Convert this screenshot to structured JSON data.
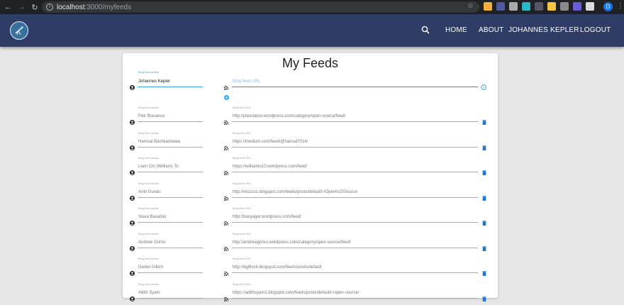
{
  "browser": {
    "url_host": "localhost",
    "url_rest": ":3000/myfeeds",
    "profile_initial": "D",
    "extension_colors": [
      "#f6ad3c",
      "#4e5a9c",
      "#aaaaaa",
      "#2bb5c6",
      "#556",
      "#f4c542",
      "#8a8a8a",
      "#6a5bd8",
      "#dddddd"
    ]
  },
  "appbar": {
    "background": "#2f3d66",
    "nav": [
      "HOME",
      "ABOUT",
      "JOHANNES KEPLER",
      "LOGOUT"
    ]
  },
  "page": {
    "title": "My Feeds",
    "new_entry": {
      "author_label": "Blog feed author",
      "author_value": "Johannes Kepler",
      "url_placeholder": "Blog feed URL"
    },
    "feeds": [
      {
        "author_label": "Blog feed author",
        "author": "Petr Bouianov",
        "url_label": "Blog feed URL",
        "url": "http://pboulanov.wordpress.com/category/open-source/feed/"
      },
      {
        "author_label": "Blog feed author",
        "author": "Hamsal Bachkaniwala",
        "url_label": "Blog feed URL",
        "url": "https://medium.com/feed/@hansal7014/"
      },
      {
        "author_label": "Blog feed author",
        "author": "Liam Chi (William) To",
        "url_label": "Blog feed URL",
        "url": "https://williamto10.wordpress.com/feed/"
      },
      {
        "author_label": "Blog feed author",
        "author": "Amit Gundu",
        "url_label": "Blog feed URL",
        "url": "http://mozcoz.blogspot.com/feeds/posts/default/-/Open%20Source"
      },
      {
        "author_label": "Blog feed author",
        "author": "Slava Basatski",
        "url_label": "Blog feed URL",
        "url": "http://basyager.wordpress.com/feed/"
      },
      {
        "author_label": "Blog feed author",
        "author": "Andrew Grimo",
        "url_label": "Blog feed URL",
        "url": "http://andrewgrimo.wordpress.com/category/open-source/feed/"
      },
      {
        "author_label": "Blog feed author",
        "author": "Daniel Gillich",
        "url_label": "Blog feed URL",
        "url": "http://dg8loch.blogspot.com/feeds/posts/default"
      },
      {
        "author_label": "Blog feed author",
        "author": "Adith Syam",
        "url_label": "Blog feed URL",
        "url": "https://adithsyam2.blogspot.com/feeds/posts/default/-/open-source/"
      }
    ]
  },
  "colors": {
    "accent": "#3f9fe4",
    "delete": "#1976d2"
  }
}
